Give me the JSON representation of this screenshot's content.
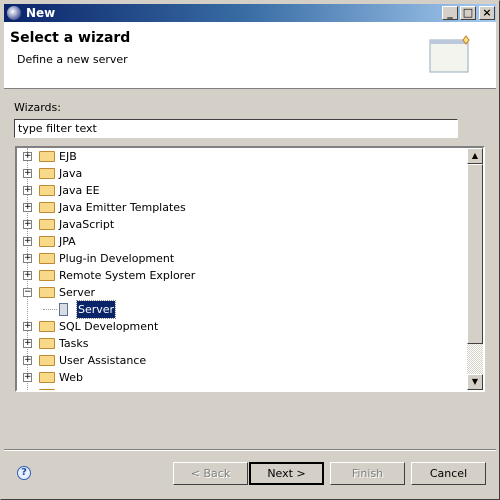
{
  "window": {
    "title": "New",
    "minimize": "_",
    "maximize": "□",
    "close": "×"
  },
  "header": {
    "title": "Select a wizard",
    "subtitle": "Define a new server"
  },
  "wizards_label": "Wizards:",
  "filter": {
    "value": "type filter text"
  },
  "tree": [
    {
      "label": "EJB",
      "expanded": false
    },
    {
      "label": "Java",
      "expanded": false
    },
    {
      "label": "Java EE",
      "expanded": false
    },
    {
      "label": "Java Emitter Templates",
      "expanded": false
    },
    {
      "label": "JavaScript",
      "expanded": false
    },
    {
      "label": "JPA",
      "expanded": false
    },
    {
      "label": "Plug-in Development",
      "expanded": false
    },
    {
      "label": "Remote System Explorer",
      "expanded": false
    },
    {
      "label": "Server",
      "expanded": true,
      "children": [
        {
          "label": "Server",
          "selected": true
        }
      ]
    },
    {
      "label": "SQL Development",
      "expanded": false
    },
    {
      "label": "Tasks",
      "expanded": false
    },
    {
      "label": "User Assistance",
      "expanded": false
    },
    {
      "label": "Web",
      "expanded": false
    }
  ],
  "buttons": {
    "help": "?",
    "back": "< Back",
    "next": "Next >",
    "finish": "Finish",
    "cancel": "Cancel"
  },
  "colors": {
    "selection": "#0a246a",
    "dialog_bg": "#d4d0c8"
  }
}
